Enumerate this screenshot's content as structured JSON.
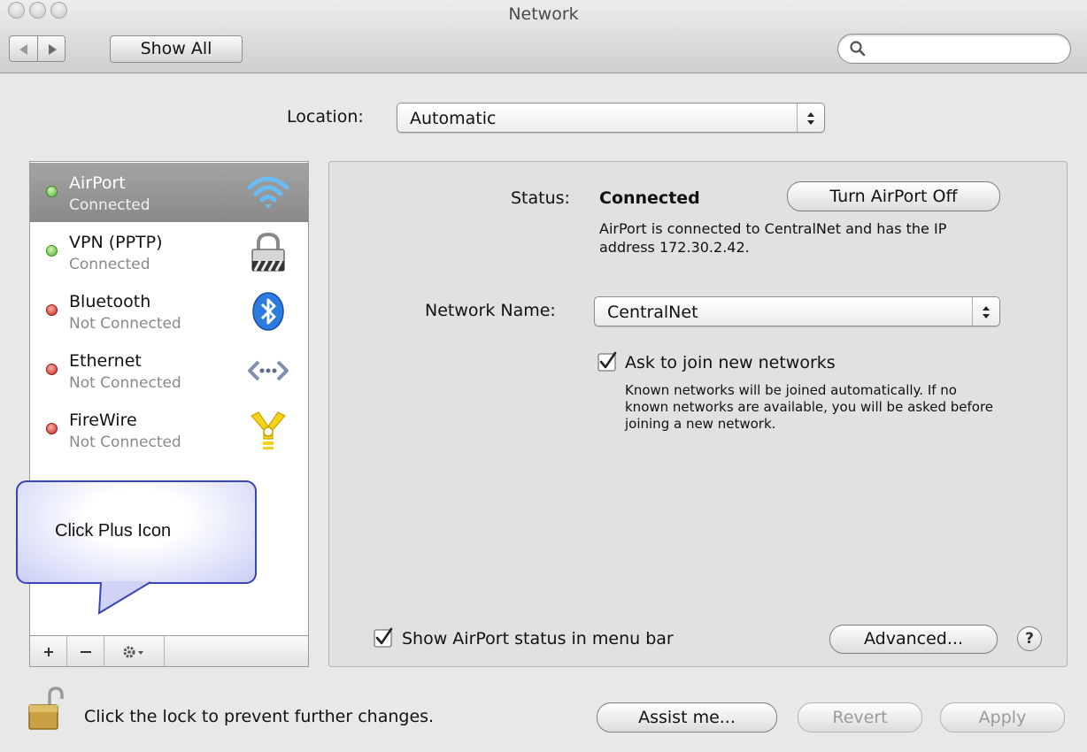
{
  "window": {
    "title": "Network"
  },
  "toolbar": {
    "back_icon": "chevron-left-icon",
    "forward_icon": "chevron-right-icon",
    "show_all_label": "Show All",
    "search_value": "",
    "search_icon": "magnifier-icon"
  },
  "location": {
    "label": "Location:",
    "value": "Automatic"
  },
  "services": [
    {
      "name": "AirPort",
      "status": "Connected",
      "indicator": "green",
      "icon": "wifi-icon",
      "selected": true
    },
    {
      "name": "VPN (PPTP)",
      "status": "Connected",
      "indicator": "green",
      "icon": "vpn-lock-icon",
      "selected": false
    },
    {
      "name": "Bluetooth",
      "status": "Not Connected",
      "indicator": "red",
      "icon": "bluetooth-icon",
      "selected": false
    },
    {
      "name": "Ethernet",
      "status": "Not Connected",
      "indicator": "red",
      "icon": "ethernet-icon",
      "selected": false
    },
    {
      "name": "FireWire",
      "status": "Not Connected",
      "indicator": "red",
      "icon": "firewire-icon",
      "selected": false
    }
  ],
  "callout": {
    "text": "Click Plus Icon"
  },
  "sidebar_bar": {
    "add_icon": "plus-icon",
    "remove_icon": "minus-icon",
    "action_icon": "gear-icon"
  },
  "detail": {
    "status_label": "Status:",
    "status_value": "Connected",
    "turn_off_label": "Turn AirPort Off",
    "status_description": "AirPort is connected to CentralNet and has the IP address 172.30.2.42.",
    "network_name_label": "Network Name:",
    "network_name_value": "CentralNet",
    "ask_to_join_label": "Ask to join new networks",
    "ask_to_join_checked": true,
    "ask_to_join_description": "Known networks will be joined automatically. If no known networks are available, you will be asked before joining a new network.",
    "show_status_label": "Show AirPort status in menu bar",
    "show_status_checked": true,
    "advanced_label": "Advanced...",
    "help_label": "?"
  },
  "footer": {
    "lock_text": "Click the lock to prevent further changes.",
    "assist_label": "Assist me...",
    "revert_label": "Revert",
    "apply_label": "Apply"
  },
  "colors": {
    "connected": "#4fb12e",
    "not_connected": "#c8261c",
    "selection": "#8f8f8f",
    "callout_border": "#3b44b8"
  }
}
